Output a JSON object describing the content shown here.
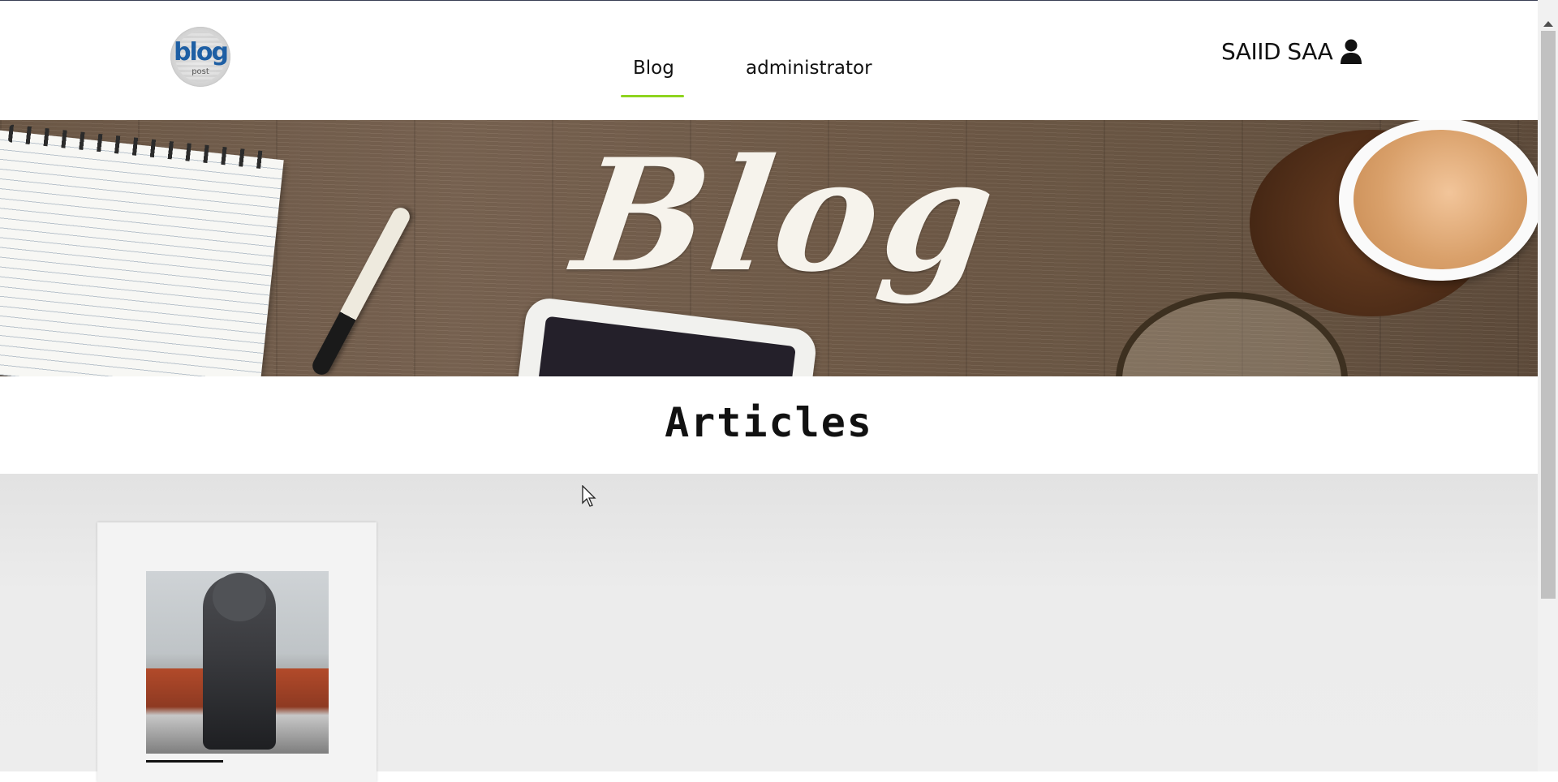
{
  "header": {
    "logo": {
      "text": "blog",
      "sub": "post",
      "icon": "blog-word-cloud-logo"
    },
    "nav": [
      {
        "label": "Blog",
        "active": true
      },
      {
        "label": "administrator",
        "active": false
      }
    ],
    "user": {
      "name": "SAIID SAA",
      "icon": "user-icon"
    },
    "accent_color": "#8ed41f"
  },
  "banner": {
    "word": "Blog"
  },
  "section": {
    "title": "Articles"
  },
  "articles": [
    {
      "image": "person-in-hoodie-on-red-car"
    }
  ]
}
